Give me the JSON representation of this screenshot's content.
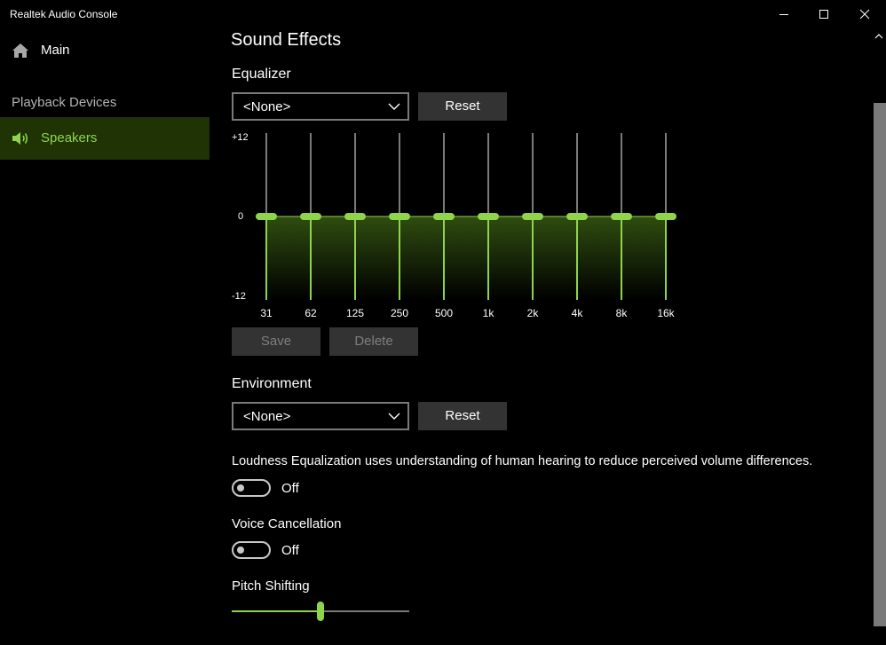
{
  "app": {
    "title": "Realtek Audio Console"
  },
  "sidebar": {
    "main_label": "Main",
    "section_heading": "Playback Devices",
    "items": [
      {
        "label": "Speakers",
        "selected": true
      }
    ]
  },
  "page": {
    "title": "Sound Effects"
  },
  "equalizer": {
    "title": "Equalizer",
    "preset": "<None>",
    "reset_label": "Reset",
    "save_label": "Save",
    "delete_label": "Delete",
    "y_labels": {
      "top": "+12",
      "mid": "0",
      "bottom": "-12"
    },
    "range_db": [
      -12,
      12
    ],
    "bands": [
      "31",
      "62",
      "125",
      "250",
      "500",
      "1k",
      "2k",
      "4k",
      "8k",
      "16k"
    ],
    "gains_db": [
      0,
      0,
      0,
      0,
      0,
      0,
      0,
      0,
      0,
      0
    ]
  },
  "environment": {
    "title": "Environment",
    "preset": "<None>",
    "reset_label": "Reset"
  },
  "loudness": {
    "description": "Loudness Equalization uses understanding of human hearing to reduce perceived volume differences.",
    "state": "Off"
  },
  "voice_cancellation": {
    "title": "Voice Cancellation",
    "state": "Off"
  },
  "pitch_shifting": {
    "title": "Pitch Shifting",
    "value_fraction": 0.5
  },
  "colors": {
    "accent": "#8fd44a",
    "selected_bg": "#1f3305",
    "button_bg": "#333333"
  }
}
